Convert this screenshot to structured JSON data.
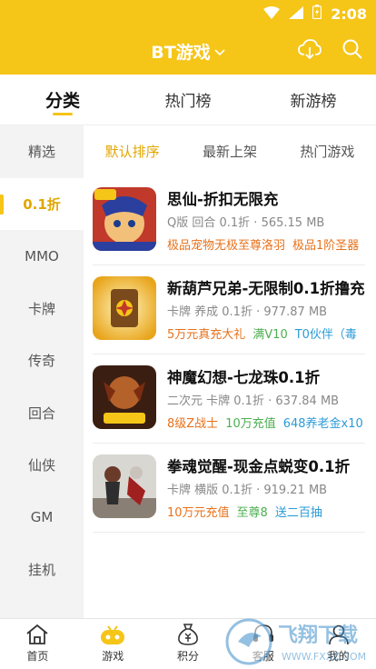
{
  "status_bar": {
    "time": "2:08",
    "icons": [
      "wifi-icon",
      "signal-icon",
      "battery-icon"
    ]
  },
  "header": {
    "title": "BT游戏",
    "icons": [
      "cloud-download-icon",
      "search-icon"
    ]
  },
  "main_tabs": [
    {
      "label": "分类",
      "active": true
    },
    {
      "label": "热门榜",
      "active": false
    },
    {
      "label": "新游榜",
      "active": false
    }
  ],
  "sidebar": {
    "items": [
      {
        "label": "精选",
        "active": false
      },
      {
        "label": "0.1折",
        "active": true
      },
      {
        "label": "MMO",
        "active": false
      },
      {
        "label": "卡牌",
        "active": false
      },
      {
        "label": "传奇",
        "active": false
      },
      {
        "label": "回合",
        "active": false
      },
      {
        "label": "仙侠",
        "active": false
      },
      {
        "label": "GM",
        "active": false
      },
      {
        "label": "挂机",
        "active": false
      },
      {
        "label": "",
        "active": false
      }
    ]
  },
  "sort_tabs": [
    {
      "label": "默认排序",
      "active": true
    },
    {
      "label": "最新上架",
      "active": false
    },
    {
      "label": "热门游戏",
      "active": false
    }
  ],
  "games": [
    {
      "name": "思仙-折扣无限充",
      "meta": "Q版 回合 0.1折 · 565.15 MB",
      "tags": [
        {
          "text": "极品宠物无极至尊洛羽",
          "color": "orange"
        },
        {
          "text": "极品1阶圣器",
          "color": "orange"
        }
      ]
    },
    {
      "name": "新葫芦兄弟-无限制0.1折撸充",
      "meta": "卡牌 养成 0.1折 · 977.87 MB",
      "tags": [
        {
          "text": "5万元真充大礼",
          "color": "orange"
        },
        {
          "text": "满V10",
          "color": "green"
        },
        {
          "text": "T0伙伴（毒",
          "color": "blue"
        }
      ]
    },
    {
      "name": "神魔幻想-七龙珠0.1折",
      "meta": "二次元 卡牌 0.1折 · 637.84 MB",
      "tags": [
        {
          "text": "8级Z战士",
          "color": "orange"
        },
        {
          "text": "10万充值",
          "color": "green"
        },
        {
          "text": "648养老金x10",
          "color": "blue"
        }
      ]
    },
    {
      "name": "拳魂觉醒-现金点蜕变0.1折",
      "meta": "卡牌 横版 0.1折 · 919.21 MB",
      "tags": [
        {
          "text": "10万元充值",
          "color": "orange"
        },
        {
          "text": "至尊8",
          "color": "green"
        },
        {
          "text": "送二百抽",
          "color": "blue"
        }
      ]
    }
  ],
  "bottom_nav": [
    {
      "label": "首页",
      "icon": "home-icon",
      "active": false
    },
    {
      "label": "游戏",
      "icon": "gamepad-icon",
      "active": true
    },
    {
      "label": "积分",
      "icon": "money-bag-icon",
      "active": false
    },
    {
      "label": "客服",
      "icon": "service-icon",
      "active": false
    },
    {
      "label": "我的",
      "icon": "user-icon",
      "active": false
    }
  ],
  "watermark": {
    "text": "飞翔下载",
    "url_text": "WWW.FXXZ.COM"
  },
  "colors": {
    "brand_yellow": "#f5c518",
    "active_text": "#e2a600",
    "tag_orange": "#e8711a",
    "tag_green": "#4caf50",
    "tag_blue": "#2a9bd8"
  }
}
